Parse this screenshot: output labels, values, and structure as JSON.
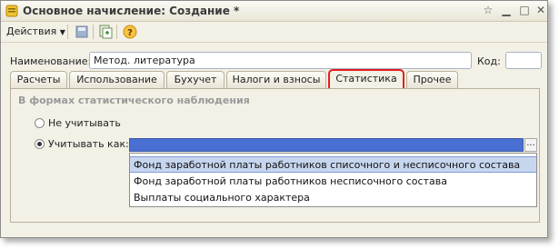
{
  "window": {
    "title": "Основное начисление: Создание *",
    "controls": [
      "star-icon",
      "minimize-icon",
      "maximize-icon",
      "close-icon"
    ]
  },
  "toolbar": {
    "actions_label": "Действия",
    "buttons": [
      "save-icon",
      "copy-icon",
      "help-icon"
    ]
  },
  "form": {
    "name_label": "Наименование:",
    "name_value": "Метод. литература",
    "code_label": "Код:",
    "code_value": ""
  },
  "tabs": [
    {
      "label": "Расчеты"
    },
    {
      "label": "Использование"
    },
    {
      "label": "Бухучет"
    },
    {
      "label": "Налоги и взносы"
    },
    {
      "label": "Статистика"
    },
    {
      "label": "Прочее"
    }
  ],
  "active_tab": "Статистика",
  "statistics": {
    "group_title": "В формах статистического наблюдения",
    "radio_none_label": "Не учитывать",
    "radio_account_label": "Учитывать как:",
    "selected_radio": "Учитывать как:",
    "combo_value": "",
    "dropdown_items": [
      "Фонд заработной платы работников списочного и несписочного состава",
      "Фонд заработной платы работников несписочного состава",
      "Выплаты социального характера"
    ],
    "dropdown_selected_index": 0
  },
  "colors": {
    "highlight_border": "#e31f1f",
    "selection": "#4a6fd3",
    "dropdown_hover": "#c7d6ef",
    "window_bg": "#f3f0e6"
  }
}
